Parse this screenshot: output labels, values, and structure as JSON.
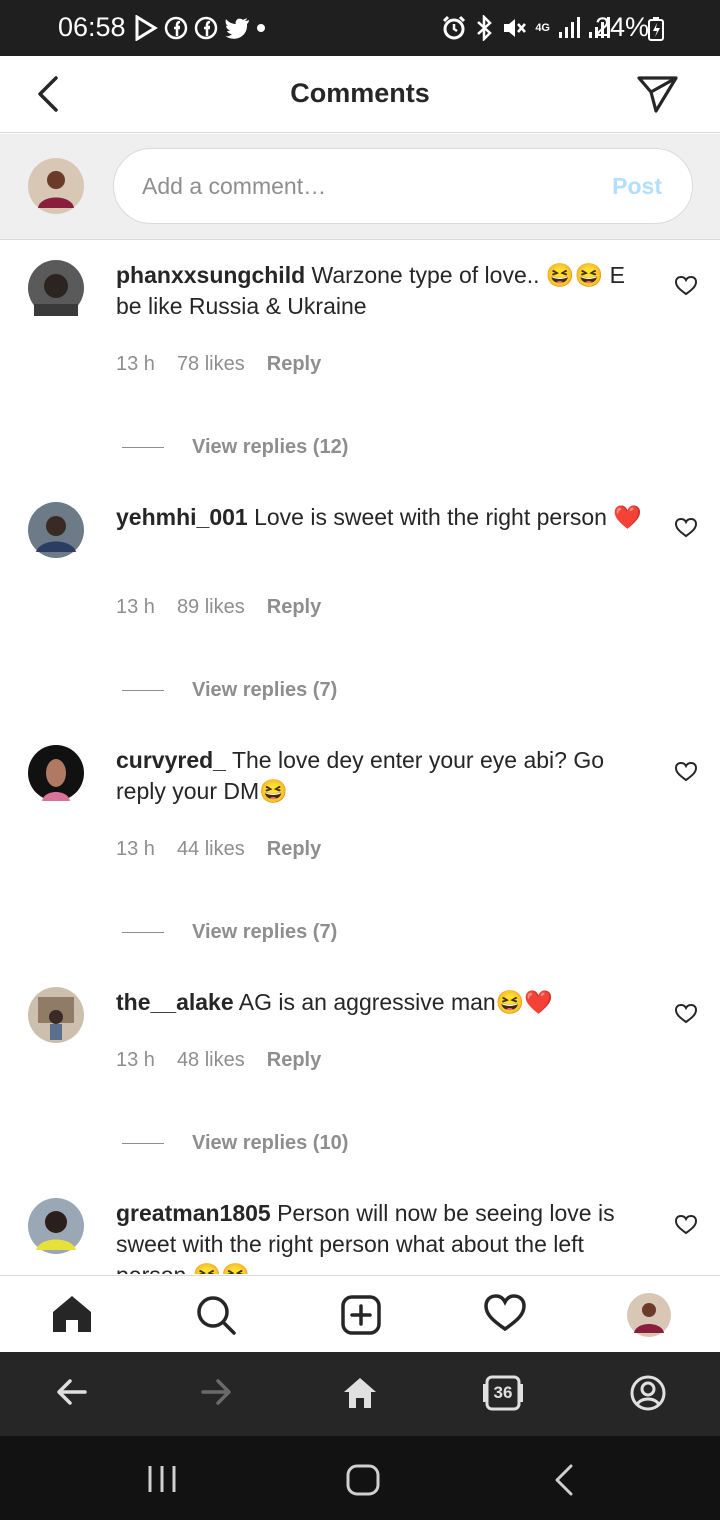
{
  "status_bar": {
    "time": "06:58",
    "battery": "24%",
    "net": "4G"
  },
  "header": {
    "title": "Comments"
  },
  "composer": {
    "placeholder": "Add a comment…",
    "post_label": "Post"
  },
  "comments": [
    {
      "username": "phanxxsungchild",
      "text": "Warzone type of love.. 😆😆 E be like Russia & Ukraine",
      "time": "13 h",
      "likes": "78 likes",
      "reply": "Reply",
      "view_replies": "View replies (12)"
    },
    {
      "username": "yehmhi_001",
      "text": "Love is sweet with the right person ❤️",
      "time": "13 h",
      "likes": "89 likes",
      "reply": "Reply",
      "view_replies": "View replies (7)"
    },
    {
      "username": "curvyred_",
      "text": "The love dey enter your eye abi? Go reply your DM😆",
      "time": "13 h",
      "likes": "44 likes",
      "reply": "Reply",
      "view_replies": "View replies (7)"
    },
    {
      "username": "the__alake",
      "text": "AG is an aggressive man😆❤️",
      "time": "13 h",
      "likes": "48 likes",
      "reply": "Reply",
      "view_replies": "View replies (10)"
    },
    {
      "username": "greatman1805",
      "text": "Person will now be seeing love is sweet with the right person what about the left person 😆😆"
    }
  ],
  "tabs": [
    "home-icon",
    "search-icon",
    "new-post-icon",
    "activity-heart-icon",
    "profile-avatar"
  ],
  "browser_bar": {
    "tab_count": "36"
  },
  "colors": {
    "accent_post_disabled": "#b2dffc",
    "meta_text": "#8e8e8e",
    "status_bar_bg": "#1f1f1f"
  }
}
